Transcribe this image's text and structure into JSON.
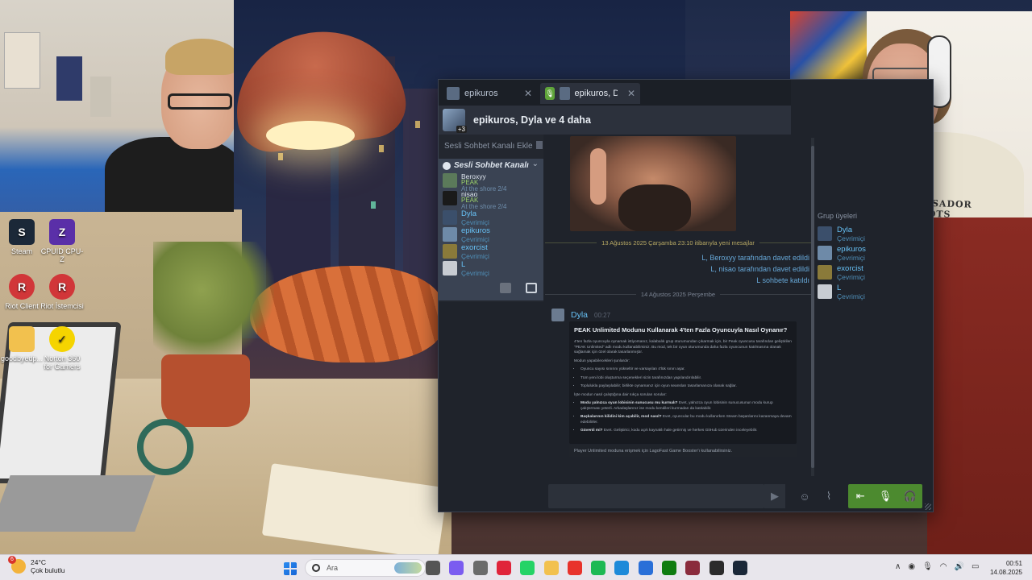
{
  "desktop": {
    "icons": [
      {
        "label": "Steam",
        "glyph": "S",
        "icon": "steam-icon",
        "color": "#1b2838"
      },
      {
        "label": "CPUID CPU-Z",
        "glyph": "Z",
        "icon": "cpuz-icon",
        "color": "#5a2fa8"
      },
      {
        "label": "Riot Client",
        "glyph": "R",
        "icon": "riot-icon",
        "color": "#d13639"
      },
      {
        "label": "Riot İstemcisi",
        "glyph": "R",
        "icon": "riot-icon",
        "color": "#d13639"
      },
      {
        "label": "goodbyedp...",
        "glyph": "",
        "icon": "folder-icon",
        "color": "#f2c14e"
      },
      {
        "label": "Norton 360 for Gamers",
        "glyph": "✓",
        "icon": "norton-icon",
        "color": "#f5d400"
      }
    ]
  },
  "webcam_right": {
    "shirt_text": "AMBASSADOR ROOTS"
  },
  "steam": {
    "tabs": [
      {
        "label": "epikuros"
      },
      {
        "label": "epikuros, Dyla"
      }
    ],
    "group": {
      "title": "epikuros, Dyla ve 4 daha",
      "badge": "+3"
    },
    "left": {
      "add_voice": "Sesli Sohbet Kanalı Ekle",
      "voice_channel": "Sesli Sohbet Kanalı",
      "voice_members": [
        {
          "name": "Beroxyy",
          "game": "PEAK",
          "status": "At the shore 2/4"
        },
        {
          "name": "nisao",
          "game": "PEAK",
          "status": "At the shore 2/4"
        }
      ],
      "friends": [
        {
          "name": "Dyla",
          "status": "Çevrimiçi"
        },
        {
          "name": "epikuros",
          "status": "Çevrimiçi"
        },
        {
          "name": "exorcist",
          "status": "Çevrimiçi"
        },
        {
          "name": "L",
          "status": "Çevrimiçi"
        }
      ]
    },
    "chat": {
      "new_messages_divider": "13 Ağustos 2025 Çarşamba 23:10 itibarıyla yeni mesajlar",
      "system_messages": [
        "L, Beroxyy tarafından davet edildi",
        "L, nisao tarafından davet edildi",
        "L sohbete katıldı"
      ],
      "date_divider": "14 Ağustos 2025 Perşembe",
      "author": "Dyla",
      "time": "00:27",
      "card_title": "PEAK Unlimited Modunu Kullanarak 4'ten Fazla Oyuncuyla Nasıl Oynanır?",
      "card_intro": "4'ten fazla oyuncuyla oynamak istiyorsanız, kalabalık grup oturumundan çıkarmak için, bir Peak oyuncusu tarafından geliştirilen \"PEAK Unlimited\" adlı modu kullanabilirsiniz. Bu mod, tek bir oyun oturumunda daha fazla oyuncunun katılmasına olanak sağlamak için özel olarak tasarlanmıştır.",
      "card_features_heading": "Modun yapabilecekleri şunlardır:",
      "card_features": [
        "Oyuncu sayısı sınırını yükseltir ve varsayılan 4'lük sınırı aşar.",
        "Tüm yeni lobi oluşturma seçenekleri sizin tarafınızdan yapılandırılabilir.",
        "Toplulukla paylaşılabilir; birlikte oynamanız için oyun seansları tasarlamanıza olanak sağlar."
      ],
      "card_faq_heading": "İşte modun nasıl çalıştığına dair sıkça sorulan sorular:",
      "card_faq": [
        {
          "q": "Modu yalnızca oyun lobisinin sunucusu mu kurmalı?",
          "a": "Evet, yalnızca oyun lobisinin sunucusunun modu kurup çalıştırması yeterli. Arkadaşlarınız ise modu kendileri kurmadan da katılabilir."
        },
        {
          "q": "Başkalarının kilidini kim açabilir, mod nasıl?",
          "a": "Evet, oyuncular bu modu kullanırken Steam başarılarını kazanmaya devam edebilirler."
        },
        {
          "q": "Güvenli mi?",
          "a": "Evet. Geliştirici, kodu açık kaynaklı hale getirmiş ve herkes GitHub üzerinden inceleyebilir."
        }
      ],
      "card_footer": "Player Unlimited moduna erişmek için LagoFast Game Booster'ı kullanabilirsiniz."
    },
    "right": {
      "title": "Grup üyeleri",
      "friends": [
        {
          "name": "Dyla",
          "status": "Çevrimiçi"
        },
        {
          "name": "epikuros",
          "status": "Çevrimiçi"
        },
        {
          "name": "exorcist",
          "status": "Çevrimiçi"
        },
        {
          "name": "L",
          "status": "Çevrimiçi"
        }
      ]
    }
  },
  "taskbar": {
    "weather_temp": "24°C",
    "weather_desc": "Çok bulutlu",
    "weather_badge": "6",
    "search_placeholder": "Ara",
    "apps": [
      {
        "icon": "task-view-icon",
        "color": "#555555"
      },
      {
        "icon": "copilot-icon",
        "color": "#7b5cf0"
      },
      {
        "icon": "settings-icon",
        "color": "#6b6b6b"
      },
      {
        "icon": "opera-icon",
        "color": "#e0243a"
      },
      {
        "icon": "whatsapp-icon",
        "color": "#25d366"
      },
      {
        "icon": "file-explorer-icon",
        "color": "#f2c14e"
      },
      {
        "icon": "anydesk-icon",
        "color": "#e8322b"
      },
      {
        "icon": "spotify-icon",
        "color": "#1db954"
      },
      {
        "icon": "edge-icon",
        "color": "#1d8ad9"
      },
      {
        "icon": "store-icon",
        "color": "#2a6fd8"
      },
      {
        "icon": "xbox-icon",
        "color": "#107c10"
      },
      {
        "icon": "app-icon",
        "color": "#8a2b3c"
      },
      {
        "icon": "obs-icon",
        "color": "#2b2b2b"
      },
      {
        "icon": "steam-icon",
        "color": "#1b2838"
      }
    ],
    "time": "00:51",
    "date": "14.08.2025"
  }
}
